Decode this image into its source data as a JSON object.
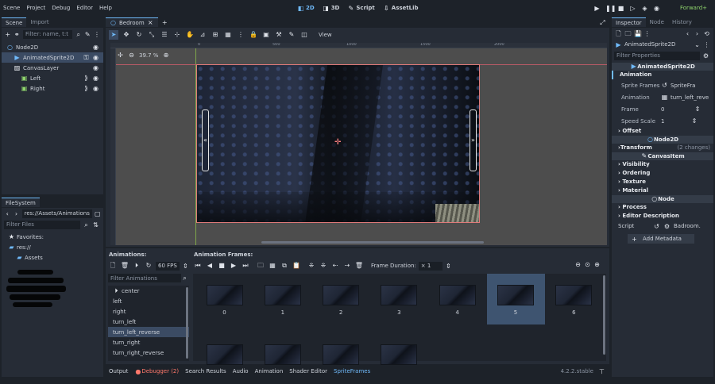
{
  "menu": {
    "items": [
      "Scene",
      "Project",
      "Debug",
      "Editor",
      "Help"
    ]
  },
  "workspaces": [
    {
      "label": "2D",
      "icon": "2d-icon",
      "active": true
    },
    {
      "label": "3D",
      "icon": "3d-icon",
      "active": false
    },
    {
      "label": "Script",
      "icon": "script-icon",
      "active": false
    },
    {
      "label": "AssetLib",
      "icon": "assetlib-icon",
      "active": false
    }
  ],
  "renderer": "Forward+",
  "colors": {
    "accent": "#70bafa",
    "bg": "#1d2229",
    "panel": "#262c36",
    "header": "#343c48",
    "selection": "#3b4b63",
    "renderer": "#8fd46c",
    "debugger": "#ff786b"
  },
  "scene_dock": {
    "tabs": [
      "Scene",
      "Import"
    ],
    "filter_placeholder": "Filter: name, t:t",
    "nodes": [
      {
        "name": "Node2D",
        "indent": 0,
        "icon": "node2d-icon"
      },
      {
        "name": "AnimatedSprite2D",
        "indent": 1,
        "icon": "animated-sprite-icon",
        "selected": true
      },
      {
        "name": "CanvasLayer",
        "indent": 1,
        "icon": "canvas-layer-icon"
      },
      {
        "name": "Left",
        "indent": 2,
        "icon": "button-icon"
      },
      {
        "name": "Right",
        "indent": 2,
        "icon": "button-icon"
      }
    ]
  },
  "filesystem": {
    "tab": "FileSystem",
    "path": "res://Assets/Animations/Im",
    "filter_placeholder": "Filter Files",
    "favorites": "Favorites:",
    "root": "res://",
    "folder": "Assets"
  },
  "viewport": {
    "tab": "Bedroom",
    "view_label": "View",
    "zoom": "39.7 %",
    "ruler_labels": [
      "0",
      "500",
      "1000",
      "1500",
      "2000"
    ]
  },
  "animations_panel": {
    "title": "Animations:",
    "fps": "60 FPS",
    "filter_placeholder": "Filter Animations",
    "items": [
      "center",
      "left",
      "right",
      "turn_left",
      "turn_left_reverse",
      "turn_right",
      "turn_right_reverse"
    ],
    "selected": "turn_left_reverse"
  },
  "frames_panel": {
    "title": "Animation Frames:",
    "duration_label": "Frame Duration:",
    "duration_value": "× 1",
    "frames": [
      "0",
      "1",
      "2",
      "3",
      "4",
      "5",
      "6",
      "",
      "",
      "",
      ""
    ],
    "selected_frame": "5"
  },
  "bottom_tabs": [
    "Output",
    "Debugger (2)",
    "Search Results",
    "Audio",
    "Animation",
    "Shader Editor",
    "SpriteFrames"
  ],
  "version": "4.2.2.stable",
  "inspector": {
    "tabs": [
      "Inspector",
      "Node",
      "History"
    ],
    "object": "AnimatedSprite2D",
    "filter_placeholder": "Filter Properties",
    "class_header": "AnimatedSprite2D",
    "section_animation": "Animation",
    "props": [
      {
        "label": "Sprite Frames",
        "value": "SpriteFra"
      },
      {
        "label": "Animation",
        "value": "turn_left_reve"
      },
      {
        "label": "Frame",
        "value": "0"
      },
      {
        "label": "Speed Scale",
        "value": "1"
      }
    ],
    "offset": "Offset",
    "node2d": "Node2D",
    "transform": "Transform",
    "transform_changes": "(2 changes)",
    "canvasitem": "CanvasItem",
    "canvas_sections": [
      "Visibility",
      "Ordering",
      "Texture",
      "Material"
    ],
    "node": "Node",
    "node_sections": [
      "Process",
      "Editor Description"
    ],
    "script_label": "Script",
    "script_value": "Badroom.",
    "add_metadata": "Add Metadata"
  }
}
